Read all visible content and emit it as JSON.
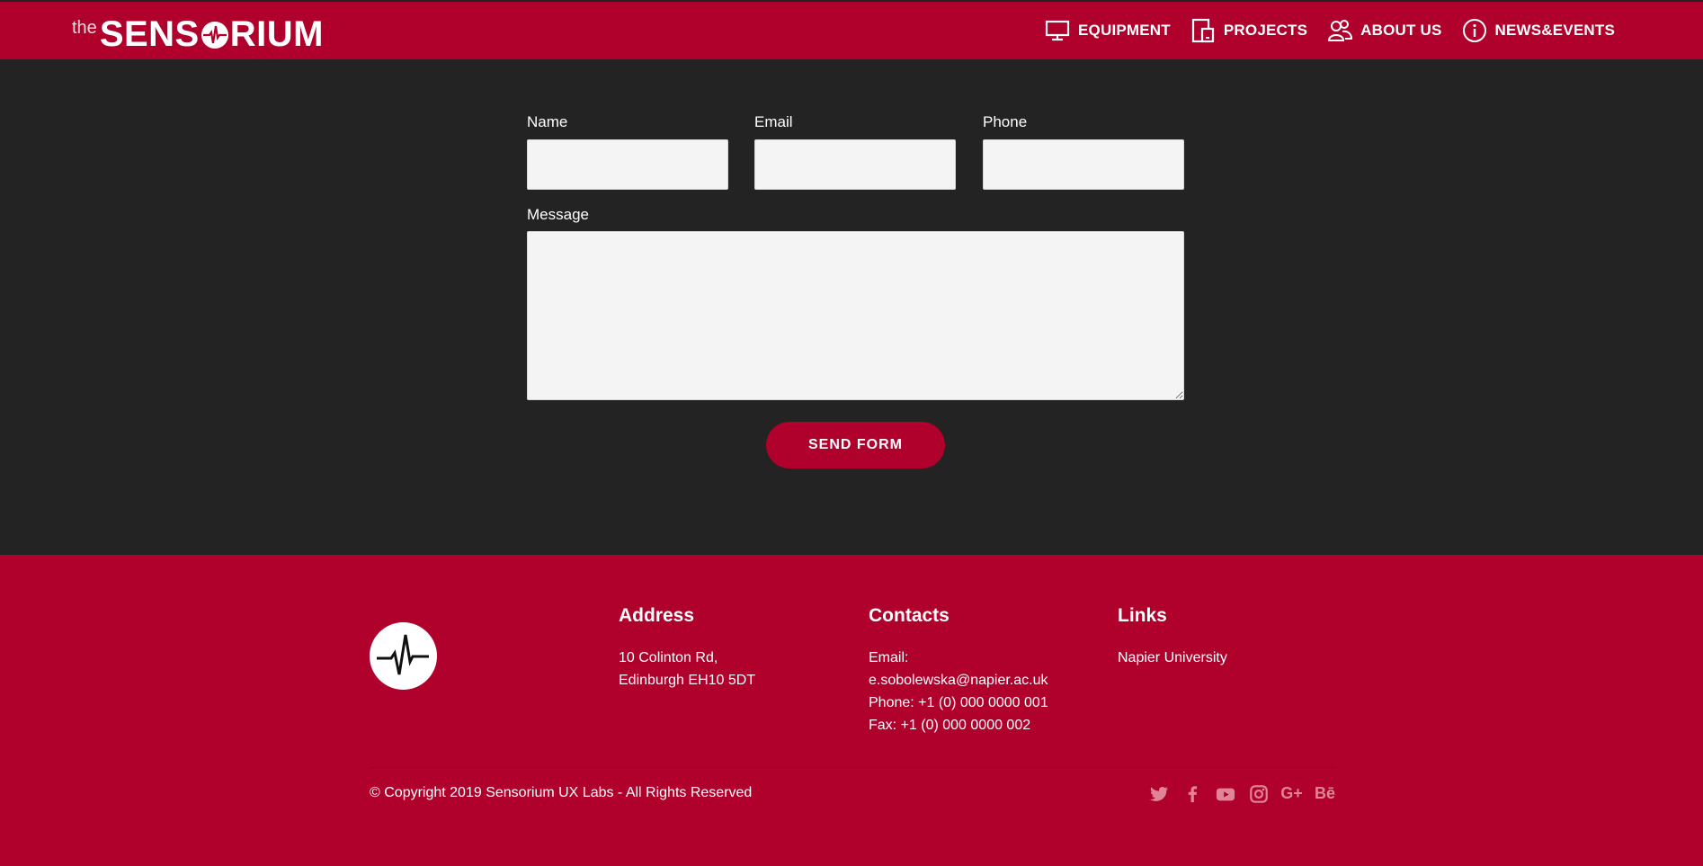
{
  "header": {
    "logo_prefix": "the",
    "logo_part1": "SENS",
    "logo_part2": "RIUM",
    "nav": [
      {
        "label": "EQUIPMENT",
        "icon": "monitor-icon"
      },
      {
        "label": "PROJECTS",
        "icon": "devices-icon"
      },
      {
        "label": "ABOUT US",
        "icon": "users-icon"
      },
      {
        "label": "NEWS&EVENTS",
        "icon": "info-icon"
      }
    ]
  },
  "form": {
    "name_label": "Name",
    "name_value": "",
    "email_label": "Email",
    "email_value": "",
    "phone_label": "Phone",
    "phone_value": "",
    "message_label": "Message",
    "message_value": "",
    "submit_label": "SEND FORM"
  },
  "footer": {
    "address": {
      "heading": "Address",
      "line1": "10 Colinton Rd,",
      "line2": "Edinburgh EH10 5DT"
    },
    "contacts": {
      "heading": "Contacts",
      "email_label": "Email:",
      "email": "e.sobolewska@napier.ac.uk",
      "phone": "Phone: +1 (0) 000 0000 001",
      "fax": "Fax: +1 (0) 000 0000 002"
    },
    "links": {
      "heading": "Links",
      "items": [
        "Napier University"
      ]
    },
    "copyright": "© Copyright 2019 Sensorium UX Labs - All Rights Reserved",
    "social": [
      "twitter-icon",
      "facebook-icon",
      "youtube-icon",
      "instagram-icon",
      "google-plus-icon",
      "behance-icon"
    ],
    "social_glyphs": {
      "google_plus": "G+",
      "behance": "Bē"
    }
  },
  "colors": {
    "brand_red": "#b0002c",
    "dark_bg": "#232323",
    "input_bg": "#f4f4f4",
    "social_icon": "#e08598"
  }
}
